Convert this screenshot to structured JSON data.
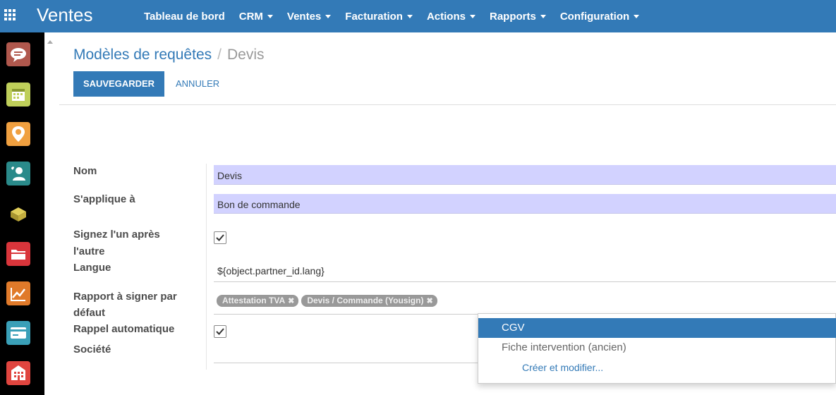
{
  "topbar": {
    "app_title": "Ventes",
    "menu": [
      {
        "label": "Tableau de bord",
        "dropdown": false
      },
      {
        "label": "CRM",
        "dropdown": true
      },
      {
        "label": "Ventes",
        "dropdown": true
      },
      {
        "label": "Facturation",
        "dropdown": true
      },
      {
        "label": "Actions",
        "dropdown": true
      },
      {
        "label": "Rapports",
        "dropdown": true
      },
      {
        "label": "Configuration",
        "dropdown": true
      }
    ]
  },
  "sidebar": {
    "apps": [
      {
        "icon": "discuss-icon",
        "color": "#b0584d"
      },
      {
        "icon": "calendar-icon",
        "color": "#bfcf5a"
      },
      {
        "icon": "map-pin-icon",
        "color": "#f0a040"
      },
      {
        "icon": "contacts-icon",
        "color": "#2a8a8a"
      },
      {
        "icon": "box-icon",
        "color": "#d8c24a"
      },
      {
        "icon": "folder-icon",
        "color": "#d9353b"
      },
      {
        "icon": "chart-icon",
        "color": "#e07a2a"
      },
      {
        "icon": "card-icon",
        "color": "#3aa0b8"
      },
      {
        "icon": "building-icon",
        "color": "#e0453f"
      }
    ]
  },
  "breadcrumb": {
    "parent": "Modèles de requêtes",
    "separator": "/",
    "current": "Devis"
  },
  "toolbar": {
    "save_label": "SAUVEGARDER",
    "cancel_label": "ANNULER"
  },
  "form": {
    "nom_label": "Nom",
    "nom_value": "Devis",
    "applique_label": "S'applique à",
    "applique_value": "Bon de commande",
    "signez_label_1": "Signez l'un après",
    "signez_label_2": "l'autre",
    "signez_checked": true,
    "langue_label": "Langue",
    "langue_value": "${object.partner_id.lang}",
    "rapport_label_1": "Rapport à signer par",
    "rapport_label_2": "défaut",
    "rapport_tags": [
      "Attestation TVA",
      "Devis / Commande (Yousign)"
    ],
    "rappel_label": "Rappel automatique",
    "rappel_checked": true,
    "societe_label": "Société"
  },
  "dropdown": {
    "options": [
      "CGV",
      "Fiche intervention (ancien)"
    ],
    "active_index": 0,
    "create_label": "Créer et modifier..."
  },
  "colors": {
    "brand": "#337ab7",
    "required_field": "#d2d2ff",
    "tag": "#999999"
  }
}
